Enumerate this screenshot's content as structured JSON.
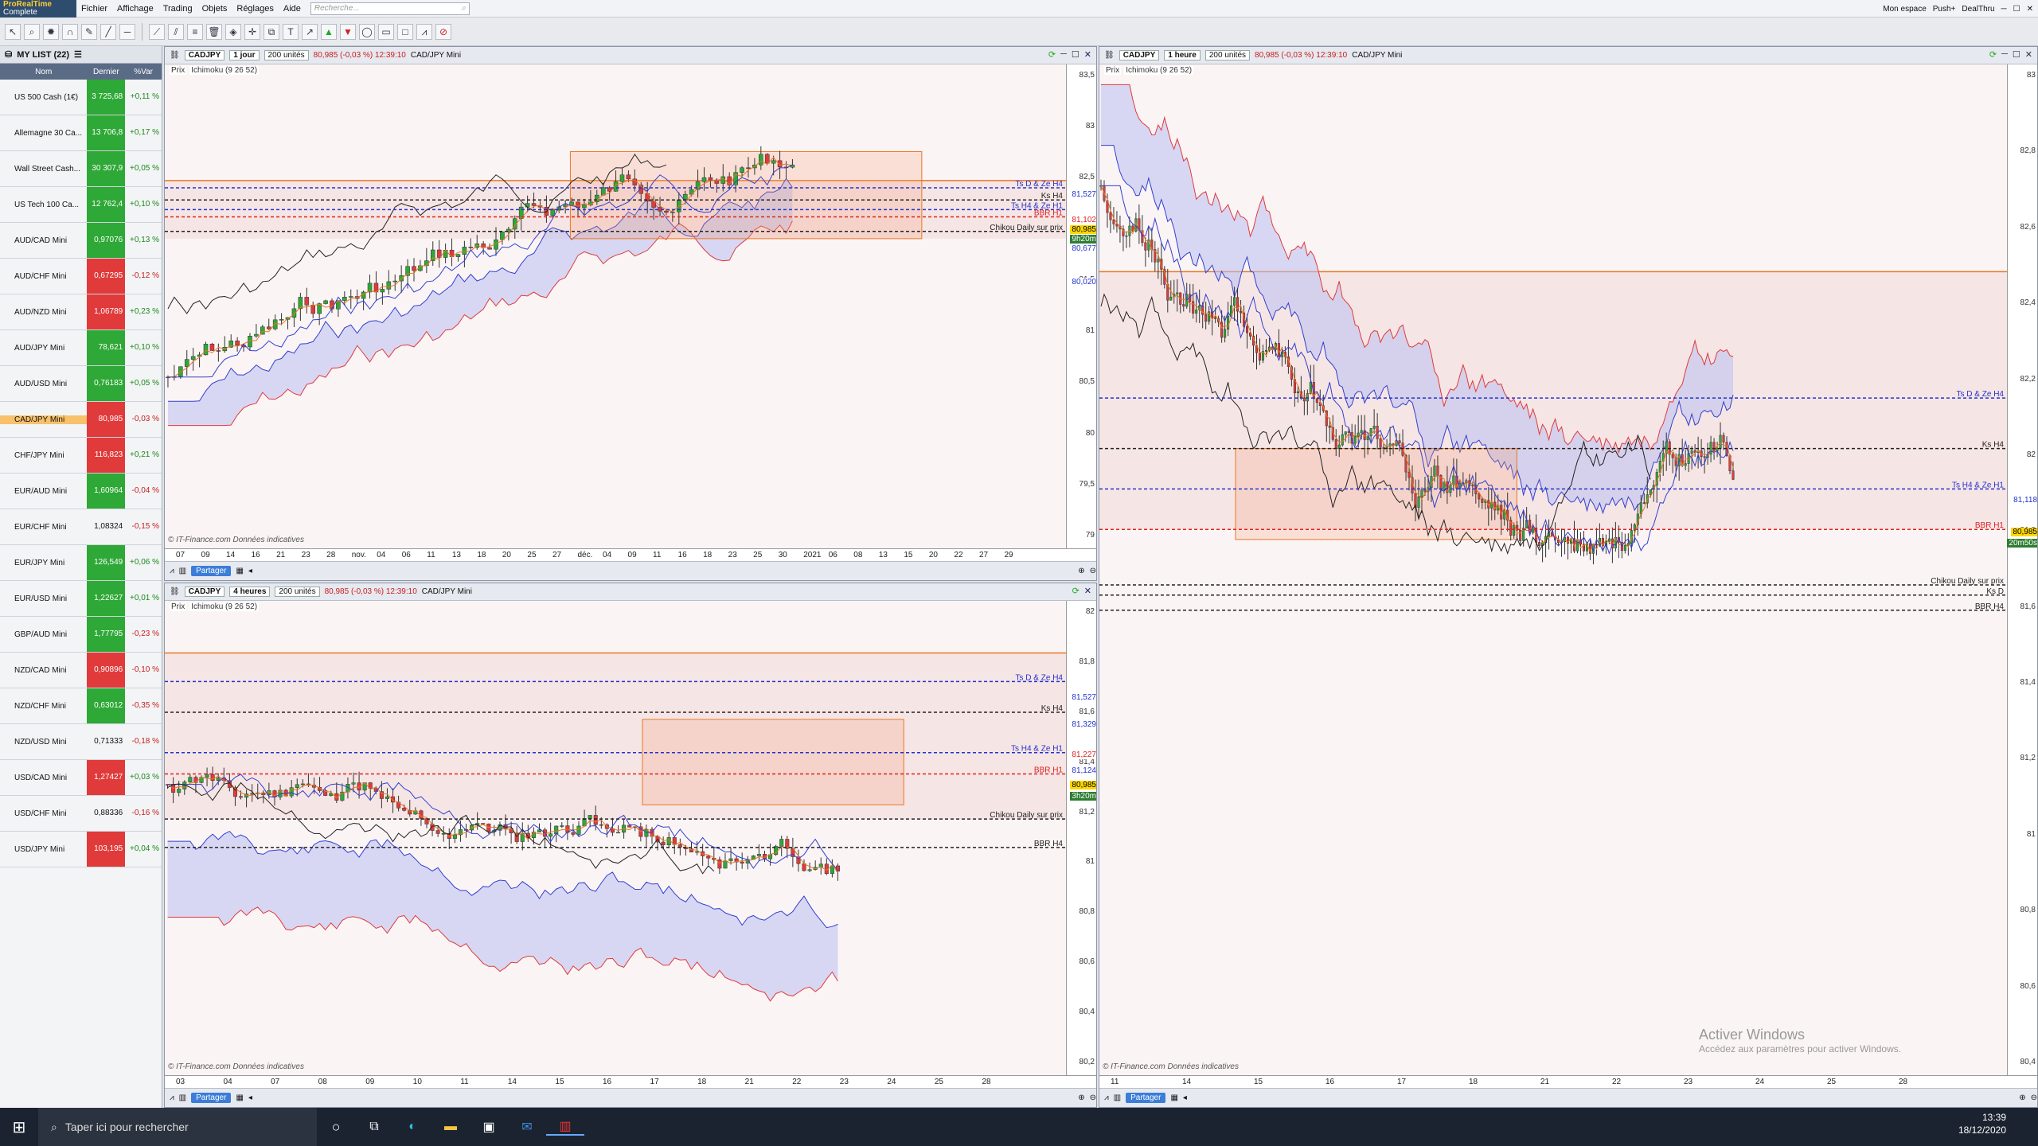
{
  "app": {
    "logo_line1": "ProRealTime",
    "logo_line2": "Complete"
  },
  "menu": [
    "Fichier",
    "Affichage",
    "Trading",
    "Objets",
    "Réglages",
    "Aide"
  ],
  "search": {
    "placeholder": "Recherche..."
  },
  "right_menu": [
    "Mon espace",
    "Push+",
    "DealThru"
  ],
  "watchlist": {
    "title": "MY LIST (22)",
    "columns": [
      "Nom",
      "Dernier",
      "%Var"
    ],
    "rows": [
      {
        "name": "US 500 Cash (1€)",
        "last": "3 725,68",
        "pct": "+0,11 %",
        "dir": "pos"
      },
      {
        "name": "Allemagne 30 Ca...",
        "last": "13 706,8",
        "pct": "+0,17 %",
        "dir": "pos"
      },
      {
        "name": "Wall Street Cash...",
        "last": "30 307,9",
        "pct": "+0,05 %",
        "dir": "pos"
      },
      {
        "name": "US Tech 100 Ca...",
        "last": "12 762,4",
        "pct": "+0,10 %",
        "dir": "pos"
      },
      {
        "name": "AUD/CAD Mini",
        "last": "0,97076",
        "pct": "+0,13 %",
        "dir": "pos"
      },
      {
        "name": "AUD/CHF Mini",
        "last": "0,67295",
        "pct": "-0,12 %",
        "dir": "neg"
      },
      {
        "name": "AUD/NZD Mini",
        "last": "1,06789",
        "pct": "+0,23 %",
        "dir": "neg"
      },
      {
        "name": "AUD/JPY Mini",
        "last": "78,621",
        "pct": "+0,10 %",
        "dir": "pos"
      },
      {
        "name": "AUD/USD Mini",
        "last": "0,76183",
        "pct": "+0,05 %",
        "dir": "pos"
      },
      {
        "name": "CAD/JPY Mini",
        "last": "80,985",
        "pct": "-0,03 %",
        "dir": "neg",
        "selected": true
      },
      {
        "name": "CHF/JPY Mini",
        "last": "116,823",
        "pct": "+0,21 %",
        "dir": "neg"
      },
      {
        "name": "EUR/AUD Mini",
        "last": "1,60964",
        "pct": "-0,04 %",
        "dir": "pos"
      },
      {
        "name": "EUR/CHF Mini",
        "last": "1,08324",
        "pct": "-0,15 %",
        "dir": "neutral"
      },
      {
        "name": "EUR/JPY Mini",
        "last": "126,549",
        "pct": "+0,06 %",
        "dir": "pos"
      },
      {
        "name": "EUR/USD Mini",
        "last": "1,22627",
        "pct": "+0,01 %",
        "dir": "pos"
      },
      {
        "name": "GBP/AUD Mini",
        "last": "1,77795",
        "pct": "-0,23 %",
        "dir": "pos"
      },
      {
        "name": "NZD/CAD Mini",
        "last": "0,90896",
        "pct": "-0,10 %",
        "dir": "neg"
      },
      {
        "name": "NZD/CHF Mini",
        "last": "0,63012",
        "pct": "-0,35 %",
        "dir": "pos"
      },
      {
        "name": "NZD/USD Mini",
        "last": "0,71333",
        "pct": "-0,18 %",
        "dir": "neutral"
      },
      {
        "name": "USD/CAD Mini",
        "last": "1,27427",
        "pct": "+0,03 %",
        "dir": "neg"
      },
      {
        "name": "USD/CHF Mini",
        "last": "0,88336",
        "pct": "-0,16 %",
        "dir": "neutral"
      },
      {
        "name": "USD/JPY Mini",
        "last": "103,195",
        "pct": "+0,04 %",
        "dir": "neg"
      }
    ]
  },
  "windows": {
    "daily": {
      "symbol": "CADJPY",
      "timeframe": "1 jour",
      "units": "200 unités",
      "quote": "80,985 (-0,03 %) 12:39:10",
      "name": "CAD/JPY Mini",
      "indicators": [
        "Prix",
        "Ichimoku (9 26 52)"
      ],
      "yticks": [
        "83,5",
        "83",
        "82,5",
        "82",
        "81,5",
        "81",
        "80,5",
        "80",
        "79,5",
        "79"
      ],
      "xticks": [
        "07",
        "09",
        "14",
        "16",
        "21",
        "23",
        "28",
        "nov.",
        "04",
        "06",
        "11",
        "13",
        "18",
        "20",
        "25",
        "27",
        "déc.",
        "04",
        "09",
        "11",
        "16",
        "18",
        "23",
        "25",
        "30",
        "2021",
        "06",
        "08",
        "13",
        "15",
        "20",
        "22",
        "27",
        "29"
      ],
      "levels": [
        "Ts D & Ze H4",
        "Ks H4",
        "Ts H4 & Ze H1",
        "BBR H1",
        "Chikou Daily sur prix"
      ],
      "tags": [
        "81,527",
        "81,102",
        "80,985",
        "9h20m",
        "80,677",
        "80,020"
      ],
      "copyright": "© IT-Finance.com  Données indicatives"
    },
    "h4": {
      "symbol": "CADJPY",
      "timeframe": "4 heures",
      "units": "200 unités",
      "quote": "80,985 (-0,03 %) 12:39:10",
      "name": "CAD/JPY Mini",
      "indicators": [
        "Prix",
        "Ichimoku (9 26 52)"
      ],
      "yticks": [
        "82",
        "81,8",
        "81,6",
        "81,4",
        "81,2",
        "81",
        "80,8",
        "80,6",
        "80,4",
        "80,2"
      ],
      "xticks": [
        "03",
        "04",
        "07",
        "08",
        "09",
        "10",
        "11",
        "14",
        "15",
        "16",
        "17",
        "18",
        "21",
        "22",
        "23",
        "24",
        "25",
        "28"
      ],
      "levels": [
        "Ts D & Ze H4",
        "Ks H4",
        "Ts H4 & Ze H1",
        "BBR H1",
        "Chikou Daily sur prix",
        "BBR H4"
      ],
      "tags": [
        "81,527",
        "81,329",
        "81,227",
        "81,124",
        "80,985",
        "3h20m"
      ],
      "copyright": "© IT-Finance.com  Données indicatives"
    },
    "h1": {
      "symbol": "CADJPY",
      "timeframe": "1 heure",
      "units": "200 unités",
      "quote": "80,985 (-0,03 %) 12:39:10",
      "name": "CAD/JPY Mini",
      "indicators": [
        "Prix",
        "Ichimoku (9 26 52)"
      ],
      "yticks": [
        "83",
        "82,8",
        "82,6",
        "82,4",
        "82,2",
        "82",
        "81,8",
        "81,6",
        "81,4",
        "81,2",
        "81",
        "80,8",
        "80,6",
        "80,4"
      ],
      "xticks": [
        "11",
        "14",
        "15",
        "16",
        "17",
        "18",
        "21",
        "22",
        "23",
        "24",
        "25",
        "28"
      ],
      "levels": [
        "Ts D & Ze H4",
        "Ks H4",
        "Ts H4 & Ze H1",
        "BBR H1",
        "Chikou Daily sur prix",
        "Ks D",
        "BBR H4"
      ],
      "tags": [
        "81,118",
        "80,985",
        "20m50s"
      ],
      "copyright": "© IT-Finance.com  Données indicatives"
    }
  },
  "bottombar": {
    "share": "Partager"
  },
  "taskbar": {
    "search": "Taper ici pour rechercher",
    "time": "13:39",
    "date": "18/12/2020"
  },
  "watermark": {
    "title": "Activer Windows",
    "subtitle": "Accédez aux paramètres pour activer Windows."
  },
  "colors": {
    "bull": "#2ea836",
    "bear": "#e03a3a",
    "cloud_bull": "#b9bff0",
    "cloud_bear": "#f0b9b9",
    "tenkan": "#e87722",
    "kijun": "#3040d0",
    "chikou": "#222222"
  }
}
